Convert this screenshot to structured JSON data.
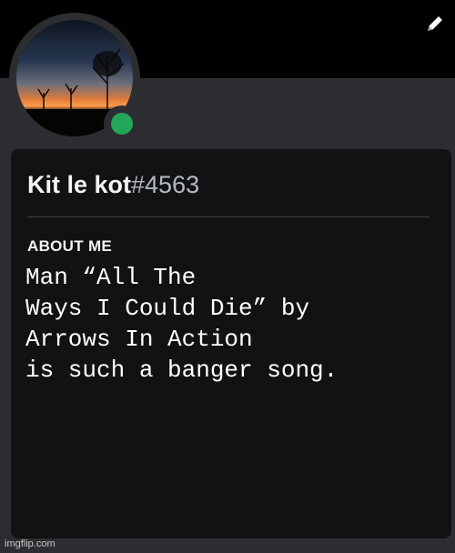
{
  "profile": {
    "username": "Kit le kot",
    "discriminator": "#4563",
    "status": "online",
    "status_color": "#23a55a"
  },
  "about": {
    "title": "ABOUT ME",
    "text": "Man “All The\nWays I Could Die” by\nArrows In Action\nis such a banger song."
  },
  "icons": {
    "edit": "pencil-icon"
  },
  "watermark": "imgflip.com"
}
